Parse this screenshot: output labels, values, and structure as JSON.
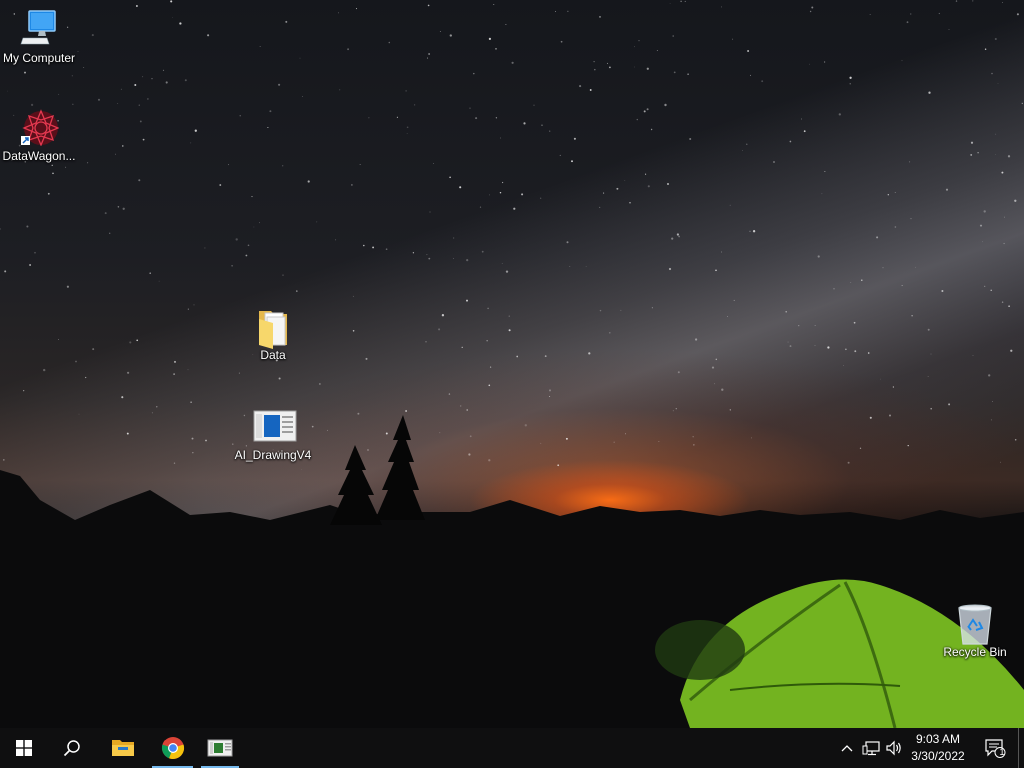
{
  "desktop": {
    "icons": [
      {
        "label": "My Computer",
        "icon": "computer-icon"
      },
      {
        "label": "DataWagon...",
        "icon": "datawagon-app-icon"
      },
      {
        "label": "Data",
        "icon": "folder-icon"
      },
      {
        "label": "AI_DrawingV4",
        "icon": "drawing-app-icon"
      },
      {
        "label": "Recycle Bin",
        "icon": "recycle-bin-icon"
      }
    ]
  },
  "taskbar": {
    "pinned": [
      {
        "icon": "windows-start-icon",
        "active": false
      },
      {
        "icon": "search-icon",
        "active": false
      },
      {
        "icon": "file-explorer-icon",
        "active": false
      },
      {
        "icon": "chrome-icon",
        "active": true
      },
      {
        "icon": "drawing-app-icon",
        "active": true
      }
    ],
    "tray": {
      "time": "9:03 AM",
      "date": "3/30/2022",
      "notification_count": "1"
    }
  },
  "colors": {
    "accent": "#76b9ed",
    "taskbar": "#0f0f10"
  }
}
